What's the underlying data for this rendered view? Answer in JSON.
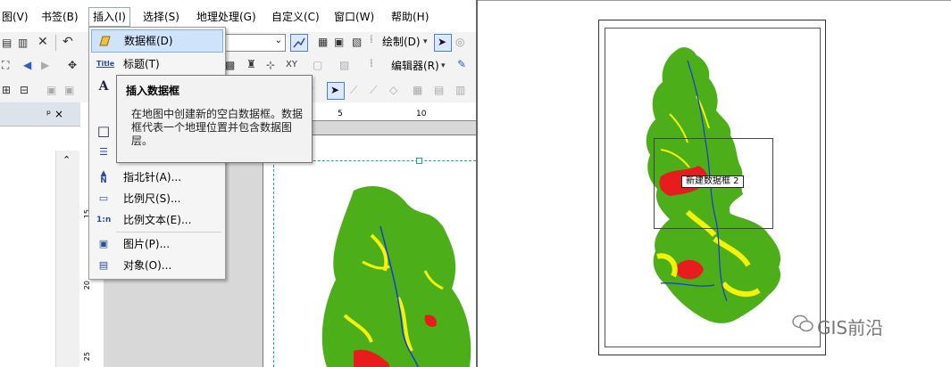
{
  "menubar": {
    "items": [
      "图(V)",
      "书签(B)",
      "插入(I)",
      "选择(S)",
      "地理处理(G)",
      "自定义(C)",
      "窗口(W)",
      "帮助(H)"
    ]
  },
  "toolbar": {
    "draw_label": "绘制(D)",
    "editor_label": "编辑器(R)"
  },
  "toc": {
    "pin": "ᵖ ×"
  },
  "ruler": {
    "top_ticks": [
      "5",
      "10"
    ],
    "left_ticks": [
      "15",
      "20",
      "25"
    ]
  },
  "insert_menu": {
    "items": [
      {
        "icon": "data-frame-icon",
        "label": "数据框(D)"
      },
      {
        "icon": "title-icon",
        "label": "标题(T)"
      },
      {
        "icon": "text-icon",
        "label": ""
      },
      {
        "icon": "neatline-icon",
        "label": ""
      },
      {
        "icon": "legend-icon",
        "label": ""
      },
      {
        "icon": "north-arrow-icon",
        "label": "指北针(A)..."
      },
      {
        "icon": "scale-bar-icon",
        "label": "比例尺(S)..."
      },
      {
        "icon": "scale-text-icon",
        "label": "比例文本(E)..."
      },
      {
        "icon": "picture-icon",
        "label": "图片(P)..."
      },
      {
        "icon": "object-icon",
        "label": "对象(O)..."
      }
    ]
  },
  "tooltip": {
    "title": "插入数据框",
    "body": "在地图中创建新的空白数据框。数据框代表一个地理位置并包含数据图层。"
  },
  "right_panel": {
    "new_frame_label": "新建数据框 2",
    "watermark": "GIS前沿"
  },
  "colors": {
    "map_green": "#4caf1a",
    "map_yellow": "#f5f20a",
    "map_red": "#e81c1c",
    "map_blue": "#1a3ad8",
    "selection": "#cfe3fb"
  }
}
